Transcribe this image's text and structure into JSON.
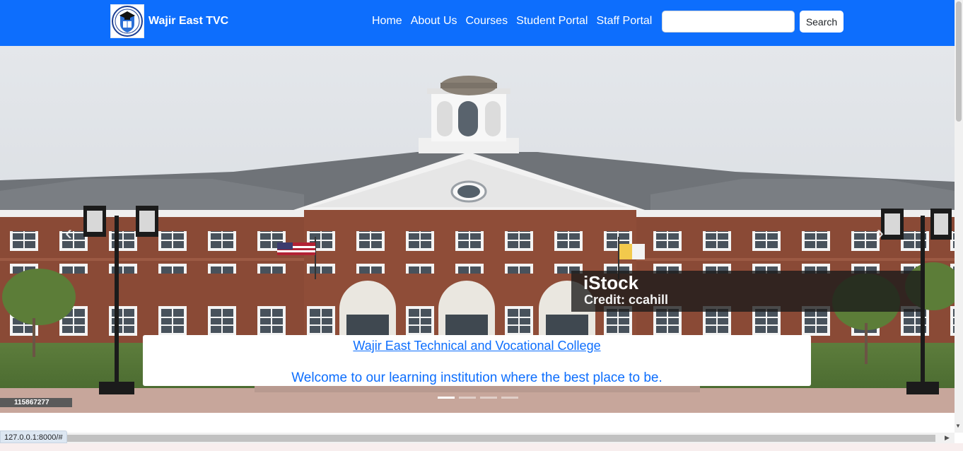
{
  "brand": {
    "name": "Wajir East TVC",
    "logo_icon": "college-crest-icon"
  },
  "nav": {
    "items": [
      {
        "label": "Home"
      },
      {
        "label": "About Us"
      },
      {
        "label": "Courses"
      },
      {
        "label": "Student Portal"
      },
      {
        "label": "Staff Portal"
      }
    ]
  },
  "search": {
    "value": "",
    "placeholder": "",
    "button_label": "Search"
  },
  "carousel": {
    "caption_title": "Wajir East Technical and Vocational College",
    "caption_subtitle": "Welcome to our learning institution where the best place to be.",
    "prev_icon": "chevron-left-icon",
    "next_icon": "chevron-right-icon",
    "slide_count": 4,
    "active_slide": 1,
    "image_watermark": {
      "title": "iStock",
      "credit": "Credit: ccahill",
      "id": "115867277"
    }
  },
  "browser": {
    "status_url": "127.0.0.1:8000/#"
  },
  "colors": {
    "primary": "#0d6efd",
    "navbar_text": "#ffffff",
    "caption_bg": "#ffffff"
  }
}
